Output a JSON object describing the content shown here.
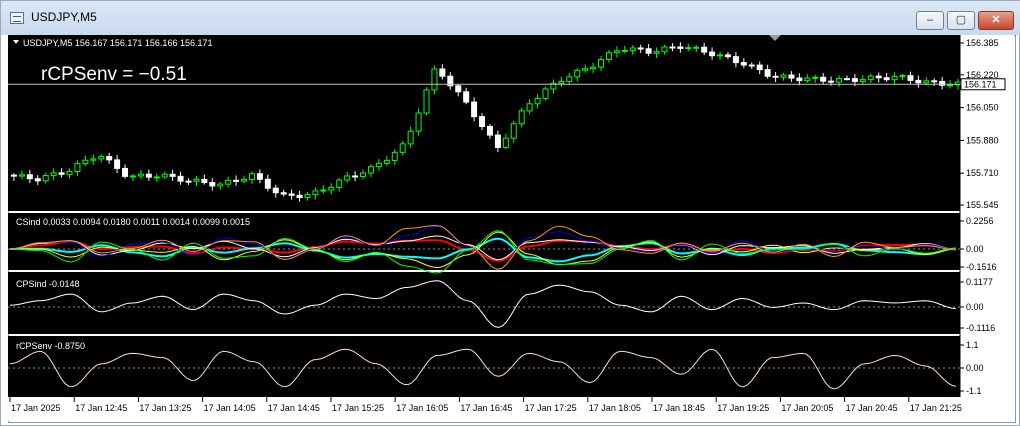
{
  "window": {
    "title": "USDJPY,M5",
    "buttons": {
      "minimize": "–",
      "maximize": "▢",
      "close": "✕"
    }
  },
  "colors": {
    "background": "#000000",
    "foreground": "#ffffff",
    "bull_candle": "#00ff00",
    "bear_candle": "#ffffff",
    "price_line": "#c0c0c0",
    "bid_label_bg": "#ffffff",
    "indicator_line": "#ffffff"
  },
  "main_panel": {
    "header": "USDJPY,M5  156.167 156.171 156.166 156.171",
    "overlay_label": "rCPSenv = −0.51",
    "current_price": "156.171",
    "price_labels": [
      "156.385",
      "156.220",
      "156.050",
      "155.880",
      "155.710",
      "155.545"
    ]
  },
  "csind_panel": {
    "header": "CSind 0.0033 0.0094 0.0180 0.0011 0.0014 0.0099 0.0015",
    "scale_labels": [
      "0.2256",
      "0.00",
      "-0.1516"
    ],
    "series_colors": [
      "#ff0000",
      "#00ffff",
      "#ffffff",
      "#ffff00",
      "#0000ff",
      "#00ff00",
      "#ff9900"
    ]
  },
  "cpsind_panel": {
    "header": "CPSind -0.0148",
    "scale_labels": [
      "0.1177",
      "0.00",
      "-0.1116"
    ]
  },
  "rcpsenv_panel": {
    "header": "rCPSenv  -0.8750",
    "scale_labels": [
      "1.1",
      "0.00",
      "-1.1"
    ]
  },
  "time_axis": {
    "labels": [
      "17 Jan 2025",
      "17 Jan 12:45",
      "17 Jan 13:25",
      "17 Jan 14:05",
      "17 Jan 14:45",
      "17 Jan 15:25",
      "17 Jan 16:05",
      "17 Jan 16:45",
      "17 Jan 17:25",
      "17 Jan 18:05",
      "17 Jan 18:45",
      "17 Jan 19:25",
      "17 Jan 20:05",
      "17 Jan 20:45",
      "17 Jan 21:25"
    ]
  },
  "chart_data": {
    "type": "line",
    "symbol": "USDJPY",
    "timeframe": "M5",
    "x": [
      "12:05",
      "12:25",
      "12:45",
      "13:05",
      "13:25",
      "13:45",
      "14:05",
      "14:25",
      "14:45",
      "15:05",
      "15:25",
      "15:45",
      "16:05",
      "16:15",
      "16:25",
      "16:45",
      "16:55",
      "17:05",
      "17:25",
      "17:45",
      "18:05",
      "18:25",
      "18:45",
      "19:05",
      "19:25",
      "19:45",
      "20:05",
      "20:25",
      "20:45",
      "21:05",
      "21:25",
      "21:40"
    ],
    "price_close": [
      155.7,
      155.68,
      155.72,
      155.81,
      155.69,
      155.7,
      155.67,
      155.65,
      155.7,
      155.59,
      155.6,
      155.68,
      155.74,
      155.86,
      156.26,
      156.07,
      155.84,
      156.07,
      156.19,
      156.26,
      156.36,
      156.34,
      156.37,
      156.33,
      156.28,
      156.21,
      156.2,
      156.19,
      156.2,
      156.21,
      156.18,
      156.171
    ],
    "cpsind": [
      0.0,
      0.02,
      0.05,
      -0.03,
      0.01,
      0.04,
      -0.02,
      0.05,
      0.02,
      -0.04,
      0.0,
      0.05,
      0.03,
      0.08,
      0.11,
      0.02,
      -0.1,
      0.05,
      0.09,
      0.06,
      0.0,
      -0.03,
      0.04,
      -0.02,
      0.03,
      -0.01,
      0.01,
      -0.02,
      0.02,
      0.01,
      0.02,
      -0.0148
    ],
    "rcpsenv": [
      0.2,
      0.8,
      -0.9,
      0.2,
      0.7,
      0.5,
      -0.6,
      0.8,
      0.3,
      -0.9,
      0.4,
      0.9,
      0.2,
      -0.8,
      0.6,
      0.9,
      -0.4,
      0.7,
      0.3,
      -0.7,
      0.8,
      0.5,
      -0.3,
      0.9,
      -0.9,
      0.5,
      0.7,
      -1.0,
      0.2,
      0.6,
      0.1,
      -0.875
    ],
    "price_ylim": [
      155.545,
      156.385
    ],
    "cpsind_ylim": [
      -0.1116,
      0.1177
    ],
    "rcpsenv_ylim": [
      -1.1,
      1.1
    ]
  }
}
